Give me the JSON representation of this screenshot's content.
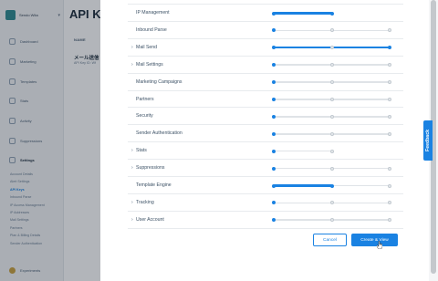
{
  "app": {
    "user_name": "Sendo Wita",
    "page_title": "API Keys",
    "column_header": "NAME",
    "key_name": "メール送信",
    "key_id_label": "API Key ID: Wf"
  },
  "sidebar": {
    "items": [
      {
        "label": "Dashboard",
        "icon": "dashboard-icon"
      },
      {
        "label": "Marketing",
        "icon": "marketing-icon"
      },
      {
        "label": "Templates",
        "icon": "templates-icon"
      },
      {
        "label": "Stats",
        "icon": "stats-icon"
      },
      {
        "label": "Activity",
        "icon": "activity-icon"
      },
      {
        "label": "Suppressions",
        "icon": "suppressions-icon"
      },
      {
        "label": "Settings",
        "icon": "settings-icon"
      }
    ],
    "settings_sub": [
      "Account Details",
      "Alert Settings",
      "API Keys",
      "Inbound Parse",
      "IP Access Management",
      "IP Addresses",
      "Mail Settings",
      "Partners",
      "Plan & Billing Details",
      "Sender Authentication"
    ],
    "active_sub_index": 2,
    "bottom_label": "Experiments"
  },
  "permissions": [
    {
      "label": "IP Management",
      "kind": "sub",
      "level": 1
    },
    {
      "label": "Inbound Parse",
      "kind": "sub",
      "level": 0
    },
    {
      "label": "Mail Send",
      "kind": "parent",
      "level": 2,
      "two_step": false
    },
    {
      "label": "Mail Settings",
      "kind": "parent",
      "level": 0
    },
    {
      "label": "Marketing Campaigns",
      "kind": "sub",
      "level": 0
    },
    {
      "label": "Partners",
      "kind": "sub",
      "level": 0
    },
    {
      "label": "Security",
      "kind": "sub",
      "level": 0
    },
    {
      "label": "Sender Authentication",
      "kind": "sub",
      "level": 0
    },
    {
      "label": "Stats",
      "kind": "parent",
      "level": 0,
      "two_step": true
    },
    {
      "label": "Suppressions",
      "kind": "parent",
      "level": 0
    },
    {
      "label": "Template Engine",
      "kind": "sub",
      "level": 1
    },
    {
      "label": "Tracking",
      "kind": "parent",
      "level": 0
    },
    {
      "label": "User Account",
      "kind": "parent",
      "level": 0
    }
  ],
  "buttons": {
    "cancel": "Cancel",
    "create": "Create & View"
  },
  "feedback_label": "Feedback",
  "colors": {
    "accent": "#1a82e2",
    "track": "#dfe3e7"
  }
}
